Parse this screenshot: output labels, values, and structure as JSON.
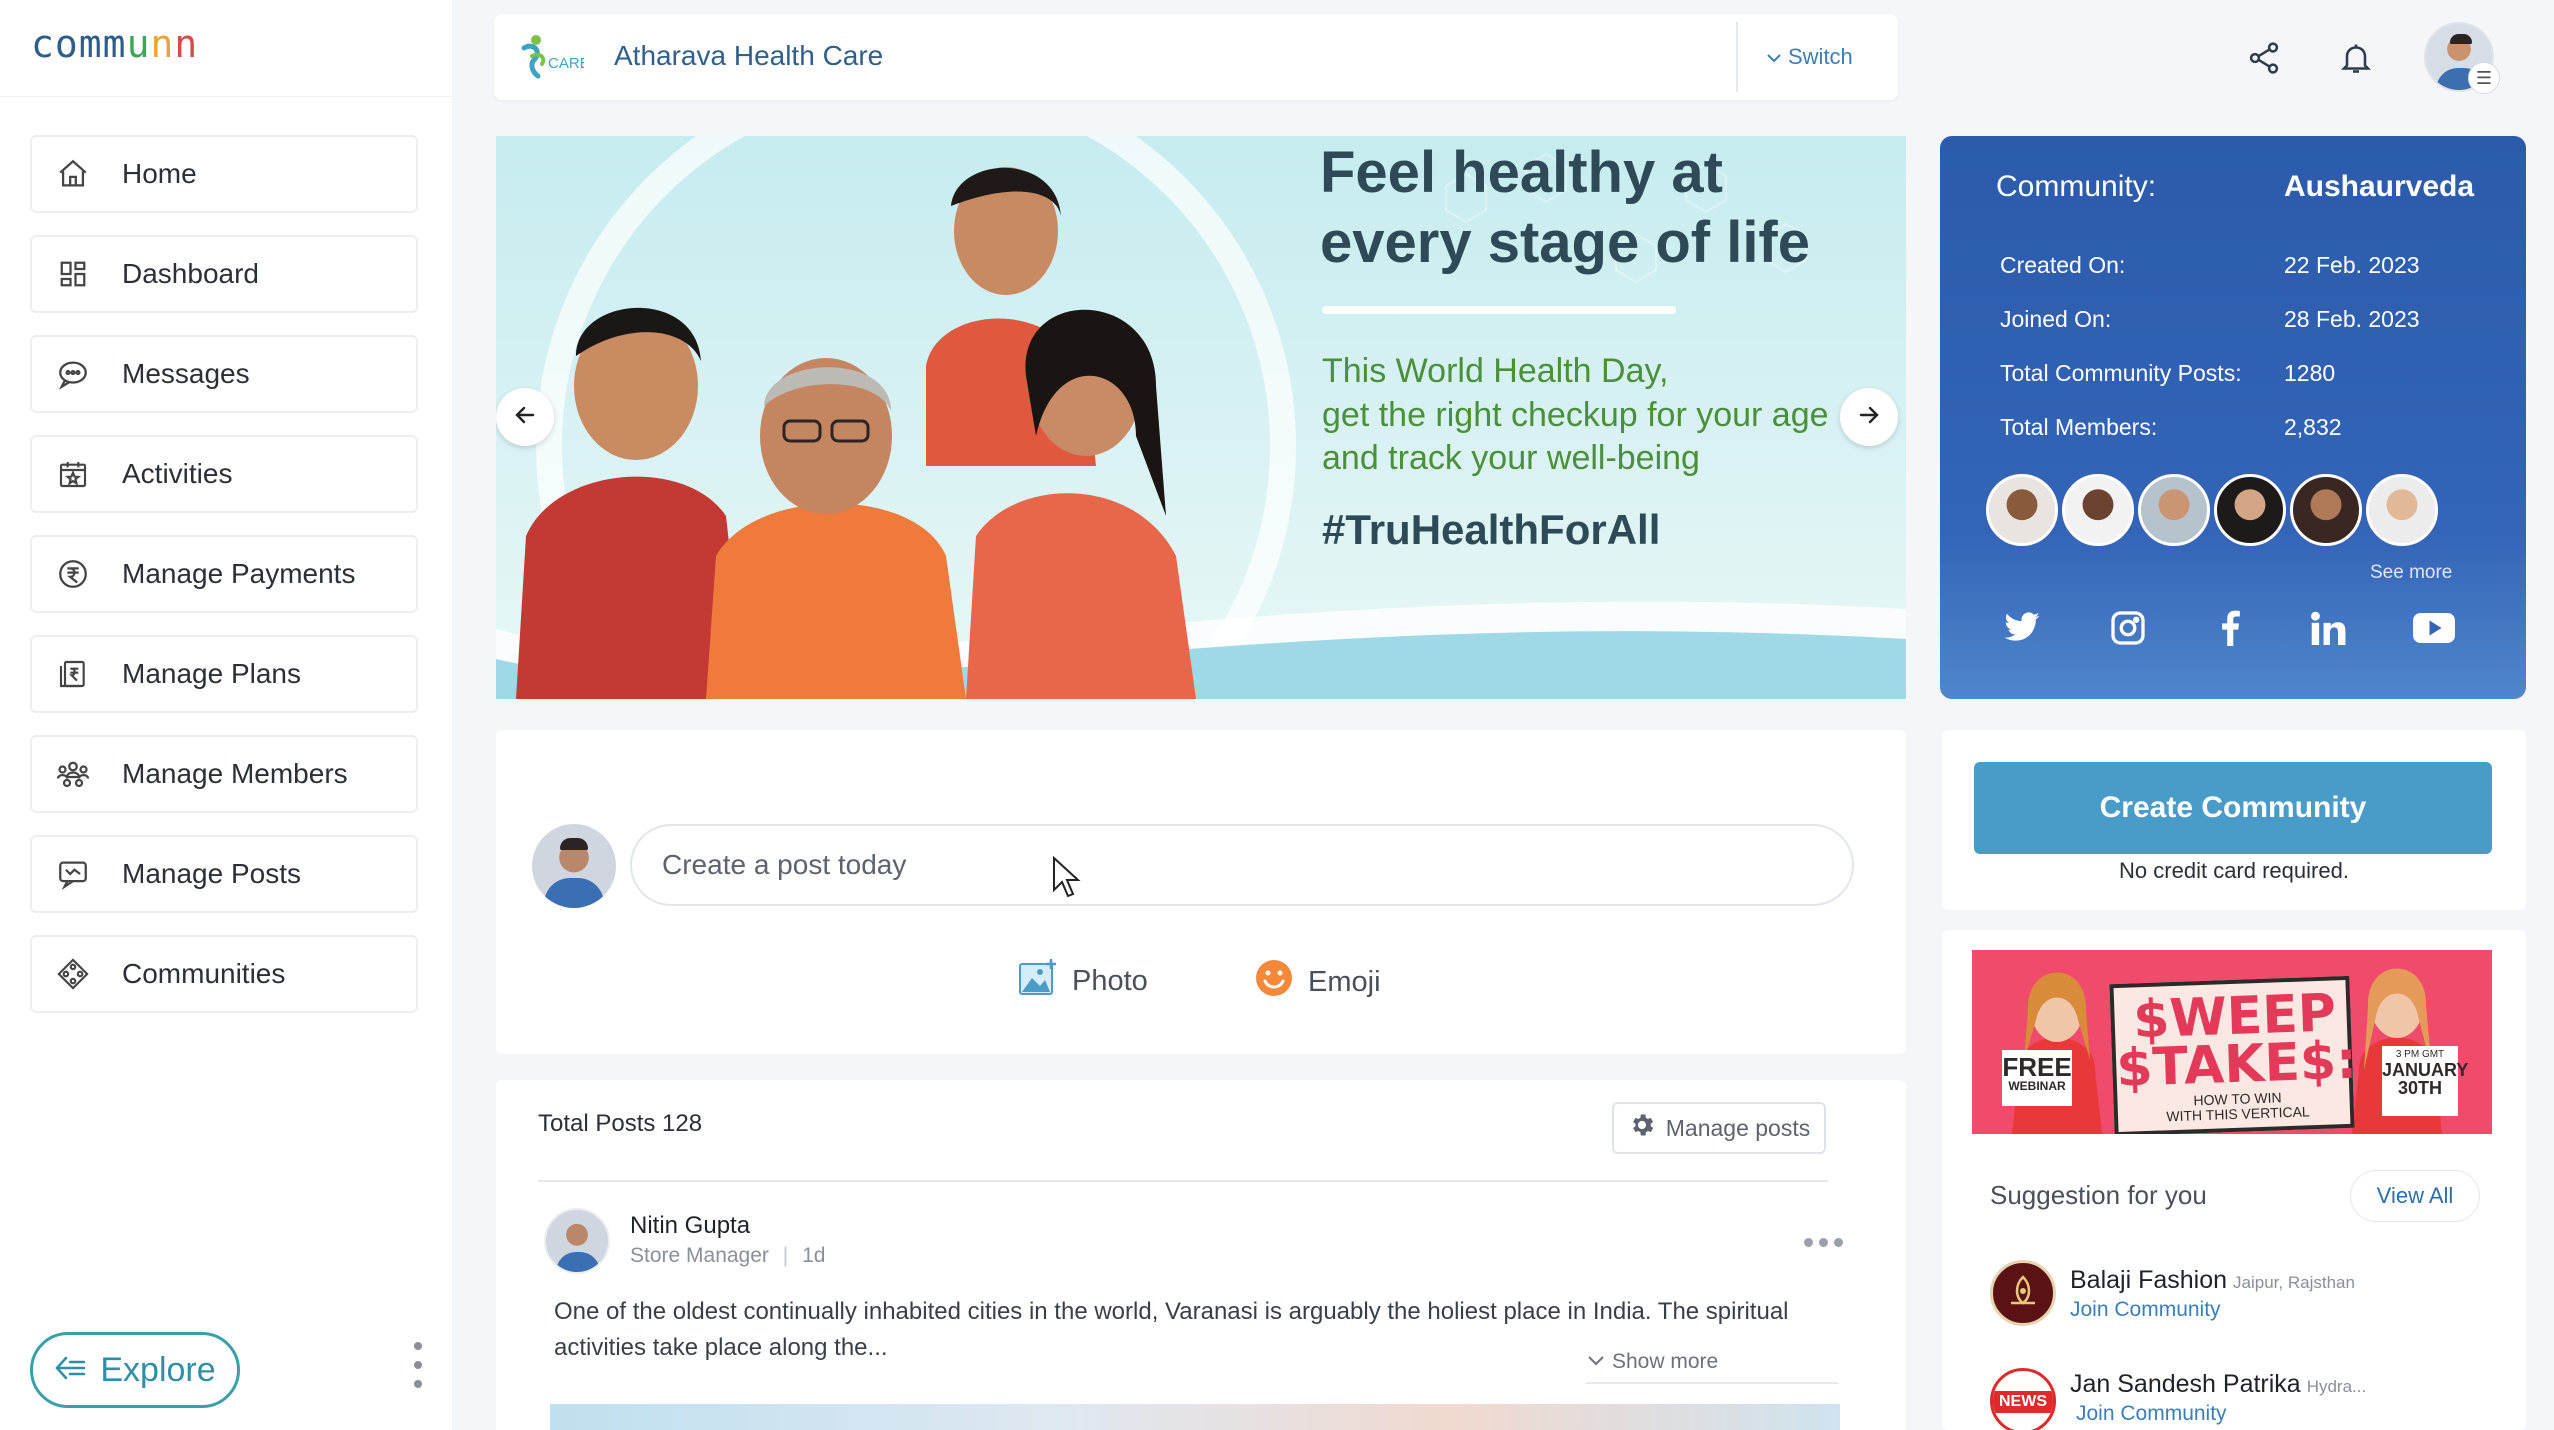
{
  "app": {
    "logo_letters": [
      "c",
      "o",
      "m",
      "m",
      "u",
      "n",
      "n"
    ],
    "logo_colors": [
      "#2e5d8a",
      "#2e5d8a",
      "#2e5d8a",
      "#2e5d8a",
      "#3aa85a",
      "#e8a43a",
      "#d94b4b"
    ]
  },
  "sidebar": {
    "items": [
      {
        "label": "Home",
        "icon": "home-icon"
      },
      {
        "label": "Dashboard",
        "icon": "dashboard-icon"
      },
      {
        "label": "Messages",
        "icon": "messages-icon"
      },
      {
        "label": "Activities",
        "icon": "activities-icon"
      },
      {
        "label": "Manage Payments",
        "icon": "payments-icon"
      },
      {
        "label": "Manage Plans",
        "icon": "plans-icon"
      },
      {
        "label": "Manage Members",
        "icon": "members-icon"
      },
      {
        "label": "Manage Posts",
        "icon": "posts-icon"
      },
      {
        "label": "Communities",
        "icon": "communities-icon"
      }
    ],
    "explore_label": "Explore"
  },
  "header": {
    "org_logo_text": "CARE",
    "org_name": "Atharava Health Care",
    "switch_label": "Switch"
  },
  "banner": {
    "title": "Feel healthy at every stage of life",
    "subtitle": "This World Health Day,\nget the right checkup for your age\nand track your well-being",
    "hashtag": "#TruHealthForAll"
  },
  "composer": {
    "placeholder": "Create a post today",
    "photo_label": "Photo",
    "emoji_label": "Emoji"
  },
  "feed": {
    "total_posts_label": "Total Posts 128",
    "manage_posts_label": "Manage posts",
    "post": {
      "author": "Nitin Gupta",
      "role": "Store Manager",
      "separator": "|",
      "time": "1d",
      "text": "One of the oldest continually inhabited cities in the world, Varanasi is arguably the holiest place in India. The spiritual activities take place along the...",
      "show_more": "Show more"
    }
  },
  "community": {
    "label": "Community:",
    "name": "Aushaurveda",
    "rows": [
      {
        "label": "Created On:",
        "value": "22 Feb. 2023"
      },
      {
        "label": "Joined On:",
        "value": "28 Feb. 2023"
      },
      {
        "label": "Total Community Posts:",
        "value": "1280"
      },
      {
        "label": "Total Members:",
        "value": "2,832"
      }
    ],
    "see_more": "See more",
    "socials": [
      "twitter-icon",
      "instagram-icon",
      "facebook-icon",
      "linkedin-icon",
      "youtube-icon"
    ]
  },
  "create_community": {
    "button": "Create Community",
    "note": "No credit card required."
  },
  "ad": {
    "free": "FREE",
    "webinar": "WEBINAR",
    "sweep_line1": "$WEEP",
    "sweep_line2": "$TAKE$:",
    "howto_line1": "HOW TO WIN",
    "howto_line2": "WITH THIS VERTICAL",
    "time": "3 PM GMT",
    "date_line1": "JANUARY",
    "date_line2": "30TH"
  },
  "suggestions": {
    "title": "Suggestion for you",
    "view_all": "View All",
    "items": [
      {
        "name": "Balaji Fashion",
        "location": "Jaipur, Rajsthan",
        "action": "Join Community"
      },
      {
        "name": "Jan Sandesh Patrika",
        "location": "Hydra...",
        "action": "Join Community",
        "logo_text": "NEWS"
      }
    ]
  },
  "colors": {
    "accent": "#3b7fb8",
    "community_card": "#2c5bab",
    "create_button": "#4a9cc8"
  }
}
